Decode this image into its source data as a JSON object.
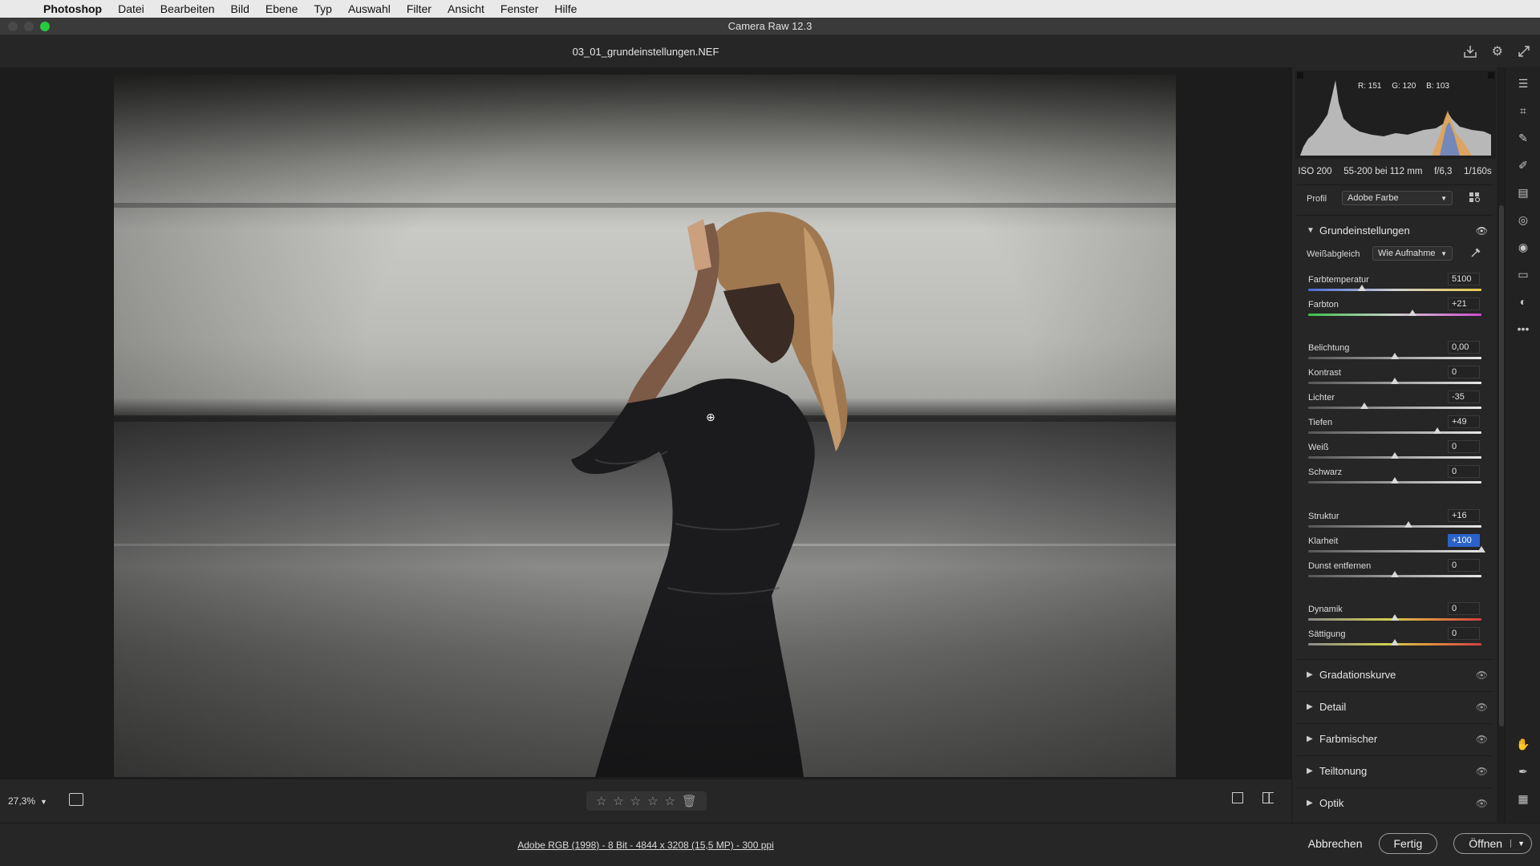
{
  "menubar": {
    "app": "Photoshop",
    "items": [
      "Datei",
      "Bearbeiten",
      "Bild",
      "Ebene",
      "Typ",
      "Auswahl",
      "Filter",
      "Ansicht",
      "Fenster",
      "Hilfe"
    ]
  },
  "window": {
    "title": "Camera Raw 12.3"
  },
  "file": {
    "name": "03_01_grundeinstellungen.NEF"
  },
  "histogram": {
    "r": "R: 151",
    "g": "G: 120",
    "b": "B: 103"
  },
  "camera": {
    "iso": "ISO 200",
    "lens": "55-200 bei 112 mm",
    "aperture": "f/6,3",
    "shutter": "1/160s"
  },
  "profile": {
    "label": "Profil",
    "value": "Adobe Farbe"
  },
  "basic": {
    "title": "Grundeinstellungen",
    "wb_label": "Weißabgleich",
    "wb_value": "Wie Aufnahme",
    "sliders": [
      {
        "label": "Farbtemperatur",
        "value": "5100",
        "pos": 0.31
      },
      {
        "label": "Farbton",
        "value": "+21",
        "pos": 0.6
      },
      {
        "label": "Belichtung",
        "value": "0,00",
        "pos": 0.5
      },
      {
        "label": "Kontrast",
        "value": "0",
        "pos": 0.5
      },
      {
        "label": "Lichter",
        "value": "-35",
        "pos": 0.325
      },
      {
        "label": "Tiefen",
        "value": "+49",
        "pos": 0.745
      },
      {
        "label": "Weiß",
        "value": "0",
        "pos": 0.5
      },
      {
        "label": "Schwarz",
        "value": "0",
        "pos": 0.5
      },
      {
        "label": "Struktur",
        "value": "+16",
        "pos": 0.58
      },
      {
        "label": "Klarheit",
        "value": "+100",
        "pos": 1.0
      },
      {
        "label": "Dunst entfernen",
        "value": "0",
        "pos": 0.5
      },
      {
        "label": "Dynamik",
        "value": "0",
        "pos": 0.5
      },
      {
        "label": "Sättigung",
        "value": "0",
        "pos": 0.5
      }
    ]
  },
  "sections": [
    "Gradationskurve",
    "Detail",
    "Farbmischer",
    "Teiltonung",
    "Optik"
  ],
  "bottombar": {
    "zoom": "27,3%"
  },
  "footer": {
    "info": "Adobe RGB (1998) - 8 Bit - 4844 x 3208 (15,5 MP) - 300 ppi",
    "cancel": "Abbrechen",
    "done": "Fertig",
    "open": "Öffnen"
  },
  "colors": {
    "accent": "#2b62c9",
    "panel": "#262626",
    "traffic_red": "#4a4a4a",
    "traffic_green": "#27c93f"
  }
}
